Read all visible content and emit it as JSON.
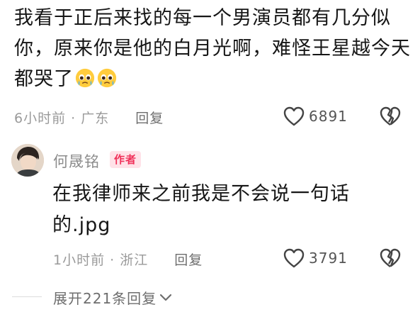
{
  "comment": {
    "text": "我看于正后来找的每一个男演员都有几分似你，原来你是他的白月光啊，难怪王星越今天都哭了",
    "emoji_icon": "pleading-face-icon",
    "time": "6小时前",
    "separator": "·",
    "location": "广东",
    "reply_label": "回复",
    "like_count": "6891"
  },
  "reply": {
    "author": "何晟铭",
    "author_badge": "作者",
    "text": "在我律师来之前我是不会说一句话的.jpg",
    "time": "1小时前",
    "separator": "·",
    "location": "浙江",
    "reply_label": "回复",
    "like_count": "3791"
  },
  "expand": {
    "label": "展开221条回复"
  },
  "colors": {
    "badge_text": "#f0315a",
    "badge_bg": "#ffe2e8",
    "meta": "#9a9a9a"
  }
}
